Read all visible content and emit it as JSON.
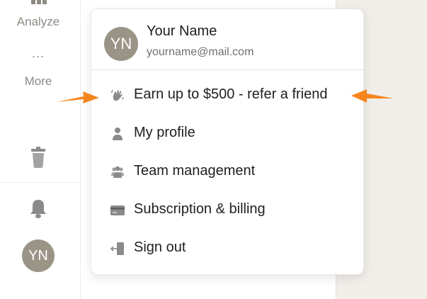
{
  "sidebar": {
    "analyze_label": "Analyze",
    "more_dots": "...",
    "more_label": "More",
    "avatar_initials": "YN"
  },
  "menu": {
    "user": {
      "initials": "YN",
      "name": "Your Name",
      "email": "yourname@mail.com"
    },
    "items": [
      {
        "label": "Earn up to $500 - refer a friend",
        "icon": "waving-hand-icon"
      },
      {
        "label": "My profile",
        "icon": "person-icon"
      },
      {
        "label": "Team management",
        "icon": "team-icon"
      },
      {
        "label": "Subscription & billing",
        "icon": "credit-card-icon"
      },
      {
        "label": "Sign out",
        "icon": "sign-out-icon"
      }
    ]
  },
  "colors": {
    "avatar": "#9a9487",
    "arrow": "#f5861f",
    "icon": "#8a8a8a",
    "right_panel": "#f1eeea"
  }
}
